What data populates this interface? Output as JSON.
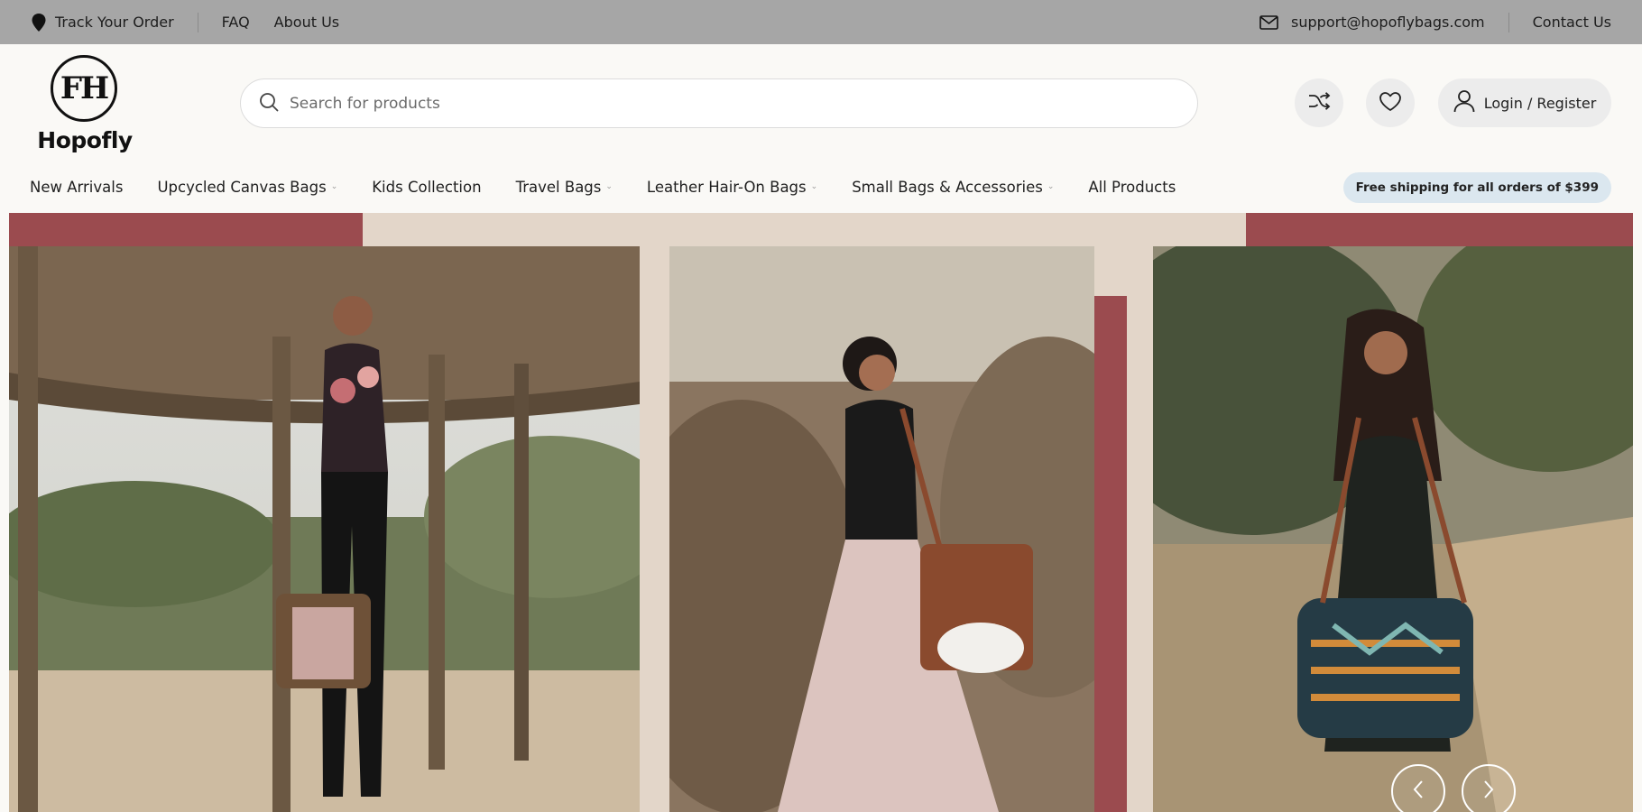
{
  "topbar": {
    "track_order": "Track Your Order",
    "faq": "FAQ",
    "about": "About Us",
    "email": "support@hopoflybags.com",
    "contact": "Contact Us"
  },
  "header": {
    "logo_monogram": "FH",
    "logo_word": "Hopofly",
    "search_placeholder": "Search for products",
    "login_label": "Login / Register"
  },
  "nav": {
    "items": [
      {
        "label": "New Arrivals",
        "dropdown": false
      },
      {
        "label": "Upcycled Canvas Bags",
        "dropdown": true
      },
      {
        "label": "Kids Collection",
        "dropdown": false
      },
      {
        "label": "Travel Bags",
        "dropdown": true
      },
      {
        "label": "Leather Hair-On Bags",
        "dropdown": true
      },
      {
        "label": "Small Bags & Accessories",
        "dropdown": true
      },
      {
        "label": "All Products",
        "dropdown": false
      }
    ],
    "shipping_badge": "Free shipping for all orders of $399"
  },
  "colors": {
    "topbar_bg": "#a6a6a6",
    "hero_bg": "#e3d6c9",
    "accent_band": "#9b4b4f",
    "badge_bg": "#dbe7ef"
  },
  "icons": {
    "location": "location-pin-icon",
    "email": "envelope-icon",
    "search": "search-icon",
    "compare": "shuffle-icon",
    "wishlist": "heart-icon",
    "user": "user-icon",
    "prev": "chevron-left-icon",
    "next": "chevron-right-icon"
  }
}
